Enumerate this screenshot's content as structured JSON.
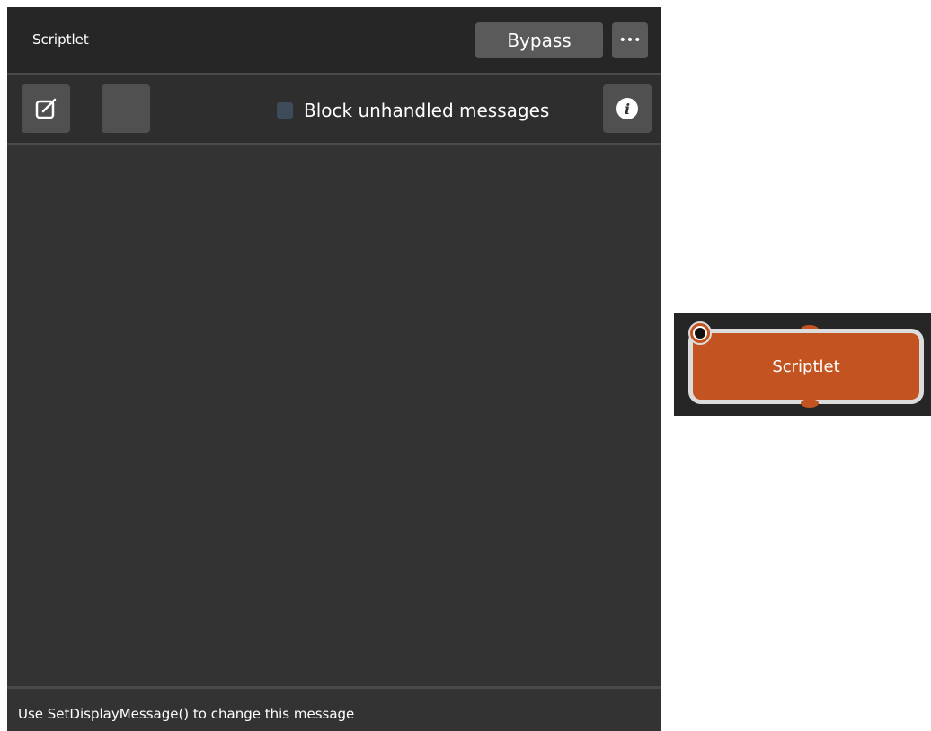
{
  "panel": {
    "title": "Scriptlet",
    "bypass_label": "Bypass",
    "more_label": "•••",
    "block_unhandled_label": "Block unhandled messages",
    "block_unhandled_checked": false,
    "info_label": "i",
    "status_message": "Use SetDisplayMessage() to change this message"
  },
  "node": {
    "label": "Scriptlet"
  },
  "icons": {
    "edit": "edit-icon",
    "info": "info-icon",
    "more": "ellipsis-icon",
    "node_badge": "midi-icon"
  },
  "colors": {
    "panel_bg": "#333333",
    "header_bg": "#262626",
    "button_bg": "#505050",
    "node_fill": "#c35421",
    "node_border": "#dcdcdc",
    "checkbox": "#3e4b5a"
  }
}
